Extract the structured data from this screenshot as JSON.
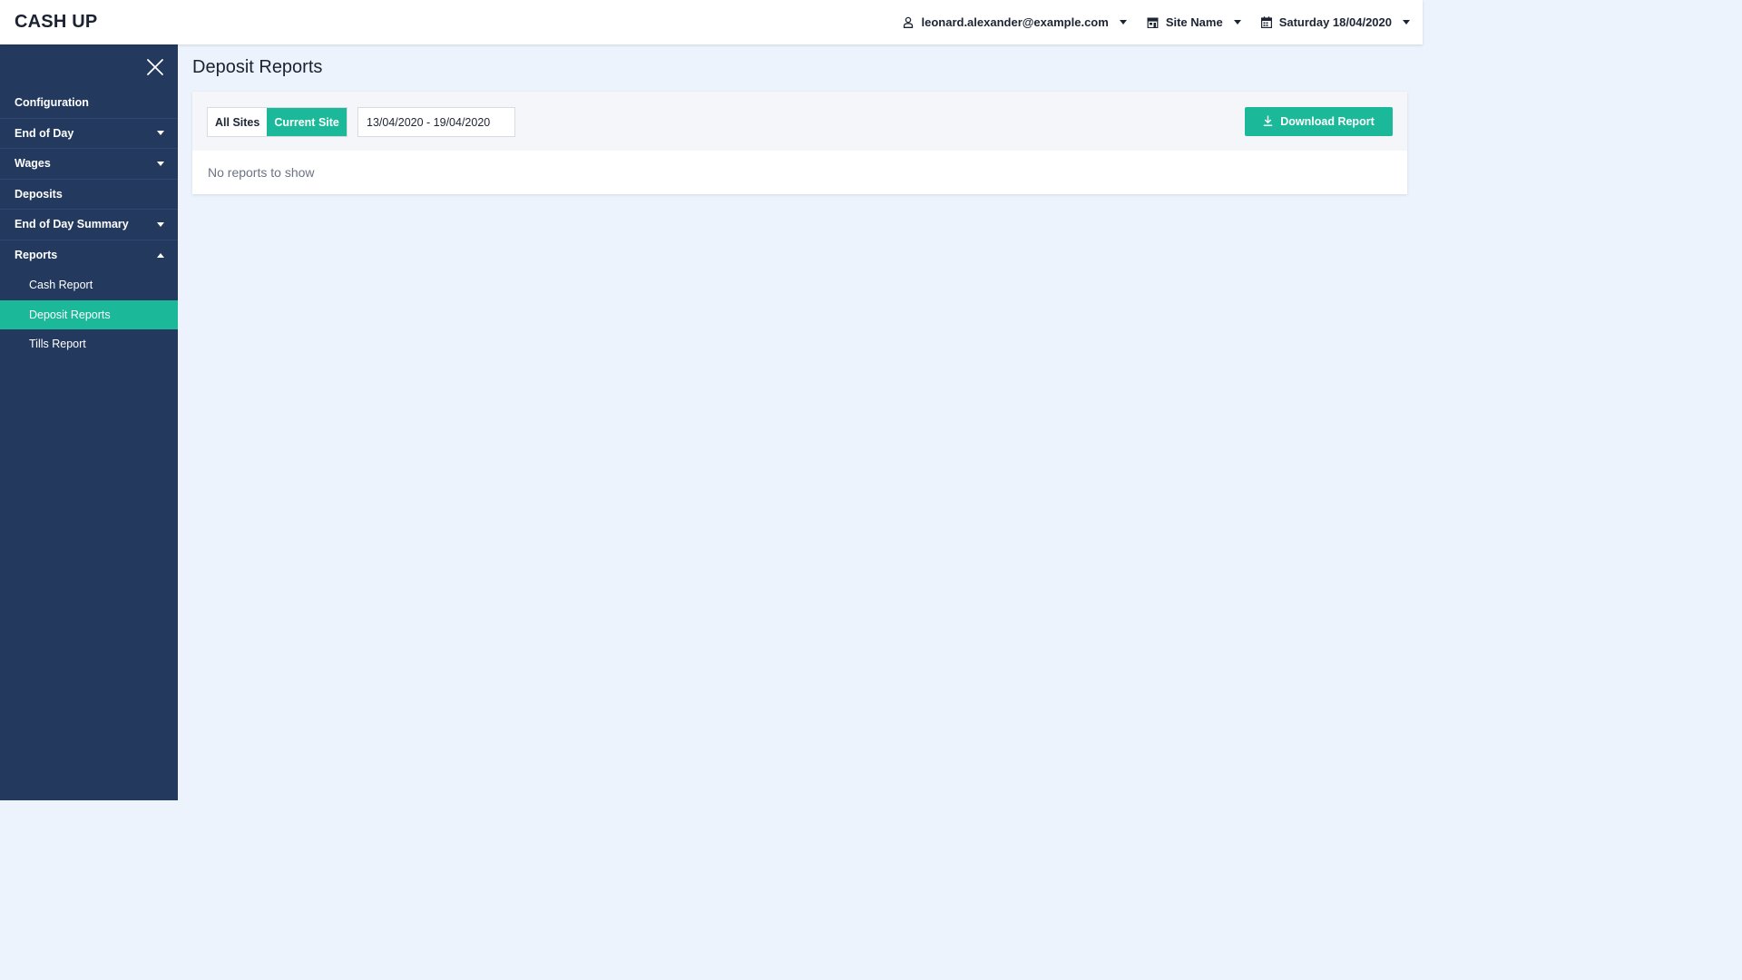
{
  "app": {
    "title": "CASH UP"
  },
  "header": {
    "user": "leonard.alexander@example.com",
    "site": "Site Name",
    "date": "Saturday 18/04/2020"
  },
  "sidebar": {
    "items": [
      {
        "label": "Configuration"
      },
      {
        "label": "End of Day"
      },
      {
        "label": "Wages"
      },
      {
        "label": "Deposits"
      },
      {
        "label": "End of Day Summary"
      },
      {
        "label": "Reports"
      }
    ],
    "reports_sub": [
      {
        "label": "Cash Report"
      },
      {
        "label": "Deposit Reports"
      },
      {
        "label": "Tills Report"
      }
    ]
  },
  "main": {
    "title": "Deposit Reports",
    "scope": {
      "all": "All Sites",
      "current": "Current Site",
      "selected": "Current Site"
    },
    "date_range": "13/04/2020 - 19/04/2020",
    "download_label": "Download Report",
    "empty_message": "No reports to show"
  },
  "colors": {
    "accent": "#1bb999",
    "sidebar": "#233a5e",
    "background": "#ecf3fc"
  },
  "icons": {
    "user": "user-icon",
    "site": "store-icon",
    "date": "calendar-icon",
    "close": "close-icon",
    "download": "download-icon"
  }
}
